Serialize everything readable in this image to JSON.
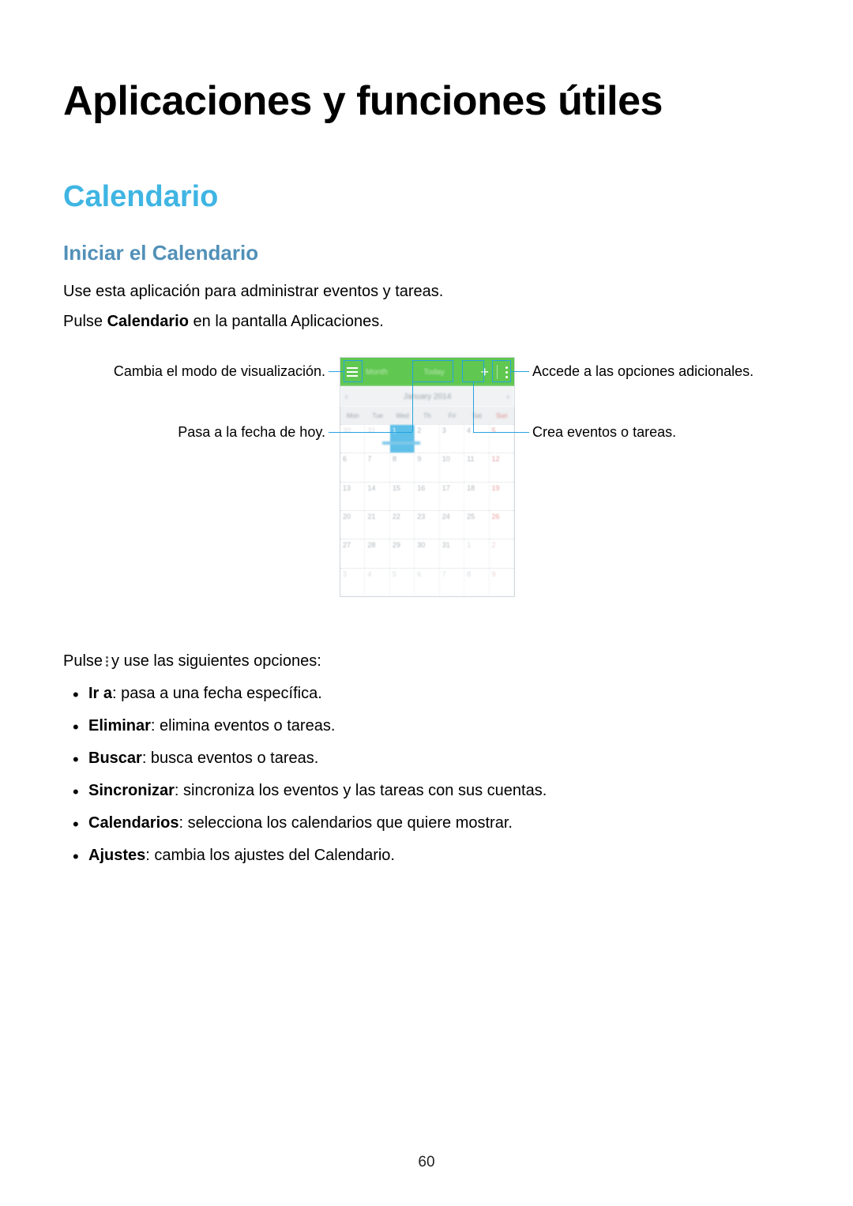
{
  "title": "Aplicaciones y funciones útiles",
  "section": "Calendario",
  "subsection": "Iniciar el Calendario",
  "intro1": "Use esta aplicación para administrar eventos y tareas.",
  "intro2_pre": "Pulse ",
  "intro2_bold": "Calendario",
  "intro2_post": " en la pantalla Aplicaciones.",
  "callouts": {
    "view_mode": "Cambia el modo de visualización.",
    "today": "Pasa a la fecha de hoy.",
    "more": "Accede a las opciones adicionales.",
    "create": "Crea eventos o tareas."
  },
  "calendar": {
    "month_label": "Month",
    "today_label": "Today",
    "nav_title": "January 2014",
    "dow": [
      "Mon",
      "Tue",
      "Wed",
      "Th",
      "Fri",
      "Sat",
      "Sun"
    ],
    "rows": [
      [
        {
          "t": "30",
          "o": true
        },
        {
          "t": "31",
          "o": true
        },
        {
          "t": "1",
          "today": true
        },
        {
          "t": "2"
        },
        {
          "t": "3"
        },
        {
          "t": "4"
        },
        {
          "t": "5",
          "sun": true
        }
      ],
      [
        {
          "t": "6"
        },
        {
          "t": "7"
        },
        {
          "t": "8"
        },
        {
          "t": "9"
        },
        {
          "t": "10"
        },
        {
          "t": "11"
        },
        {
          "t": "12",
          "sun": true
        }
      ],
      [
        {
          "t": "13"
        },
        {
          "t": "14"
        },
        {
          "t": "15"
        },
        {
          "t": "16"
        },
        {
          "t": "17"
        },
        {
          "t": "18"
        },
        {
          "t": "19",
          "sun": true
        }
      ],
      [
        {
          "t": "20"
        },
        {
          "t": "21"
        },
        {
          "t": "22"
        },
        {
          "t": "23"
        },
        {
          "t": "24"
        },
        {
          "t": "25"
        },
        {
          "t": "26",
          "sun": true
        }
      ],
      [
        {
          "t": "27"
        },
        {
          "t": "28"
        },
        {
          "t": "29"
        },
        {
          "t": "30"
        },
        {
          "t": "31"
        },
        {
          "t": "1",
          "o": true
        },
        {
          "t": "2",
          "o": true,
          "sun": true
        }
      ],
      [
        {
          "t": "3",
          "o": true
        },
        {
          "t": "4",
          "o": true
        },
        {
          "t": "5",
          "o": true
        },
        {
          "t": "6",
          "o": true
        },
        {
          "t": "7",
          "o": true
        },
        {
          "t": "8",
          "o": true
        },
        {
          "t": "9",
          "o": true,
          "sun": true
        }
      ]
    ]
  },
  "options_intro_pre": "Pulse ",
  "options_intro_post": " y use las siguientes opciones:",
  "options": [
    {
      "bold": "Ir a",
      "rest": ": pasa a una fecha específica."
    },
    {
      "bold": "Eliminar",
      "rest": ": elimina eventos o tareas."
    },
    {
      "bold": "Buscar",
      "rest": ": busca eventos o tareas."
    },
    {
      "bold": "Sincronizar",
      "rest": ": sincroniza los eventos y las tareas con sus cuentas."
    },
    {
      "bold": "Calendarios",
      "rest": ": selecciona los calendarios que quiere mostrar."
    },
    {
      "bold": "Ajustes",
      "rest": ": cambia los ajustes del Calendario."
    }
  ],
  "page_number": "60"
}
